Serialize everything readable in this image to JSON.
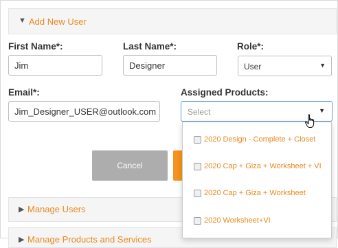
{
  "add_user_section": {
    "caret": "▼",
    "title": "Add New User"
  },
  "form": {
    "first_name": {
      "label": "First Name*:",
      "value": "Jim"
    },
    "last_name": {
      "label": "Last Name*:",
      "value": "Designer"
    },
    "role": {
      "label": "Role*:",
      "value": "User"
    },
    "email": {
      "label": "Email*:",
      "value": "Jim_Designer_USER@outlook.com"
    },
    "assigned_products": {
      "label": "Assigned Products:",
      "placeholder": "Select",
      "options": [
        {
          "label": "2020 Design - Complete + Closet",
          "checked": false
        },
        {
          "label": "2020 Cap + Giza + Worksheet + VI",
          "checked": false
        },
        {
          "label": "2020 Cap + Giza + Worksheet",
          "checked": false
        },
        {
          "label": "2020 Worksheet+VI",
          "checked": false
        }
      ]
    }
  },
  "buttons": {
    "cancel": "Cancel"
  },
  "manage_users_section": {
    "caret": "▶",
    "title": "Manage Users"
  },
  "manage_products_section": {
    "caret": "▶",
    "title": "Manage Products and Services"
  },
  "icons": {
    "dropdown_arrow": "▼",
    "cursor": "hand-pointer"
  },
  "colors": {
    "accent": "#e8891e",
    "save_button": "#f5931e",
    "cancel_button": "#adadad",
    "focus_border": "#5c9ad6"
  }
}
